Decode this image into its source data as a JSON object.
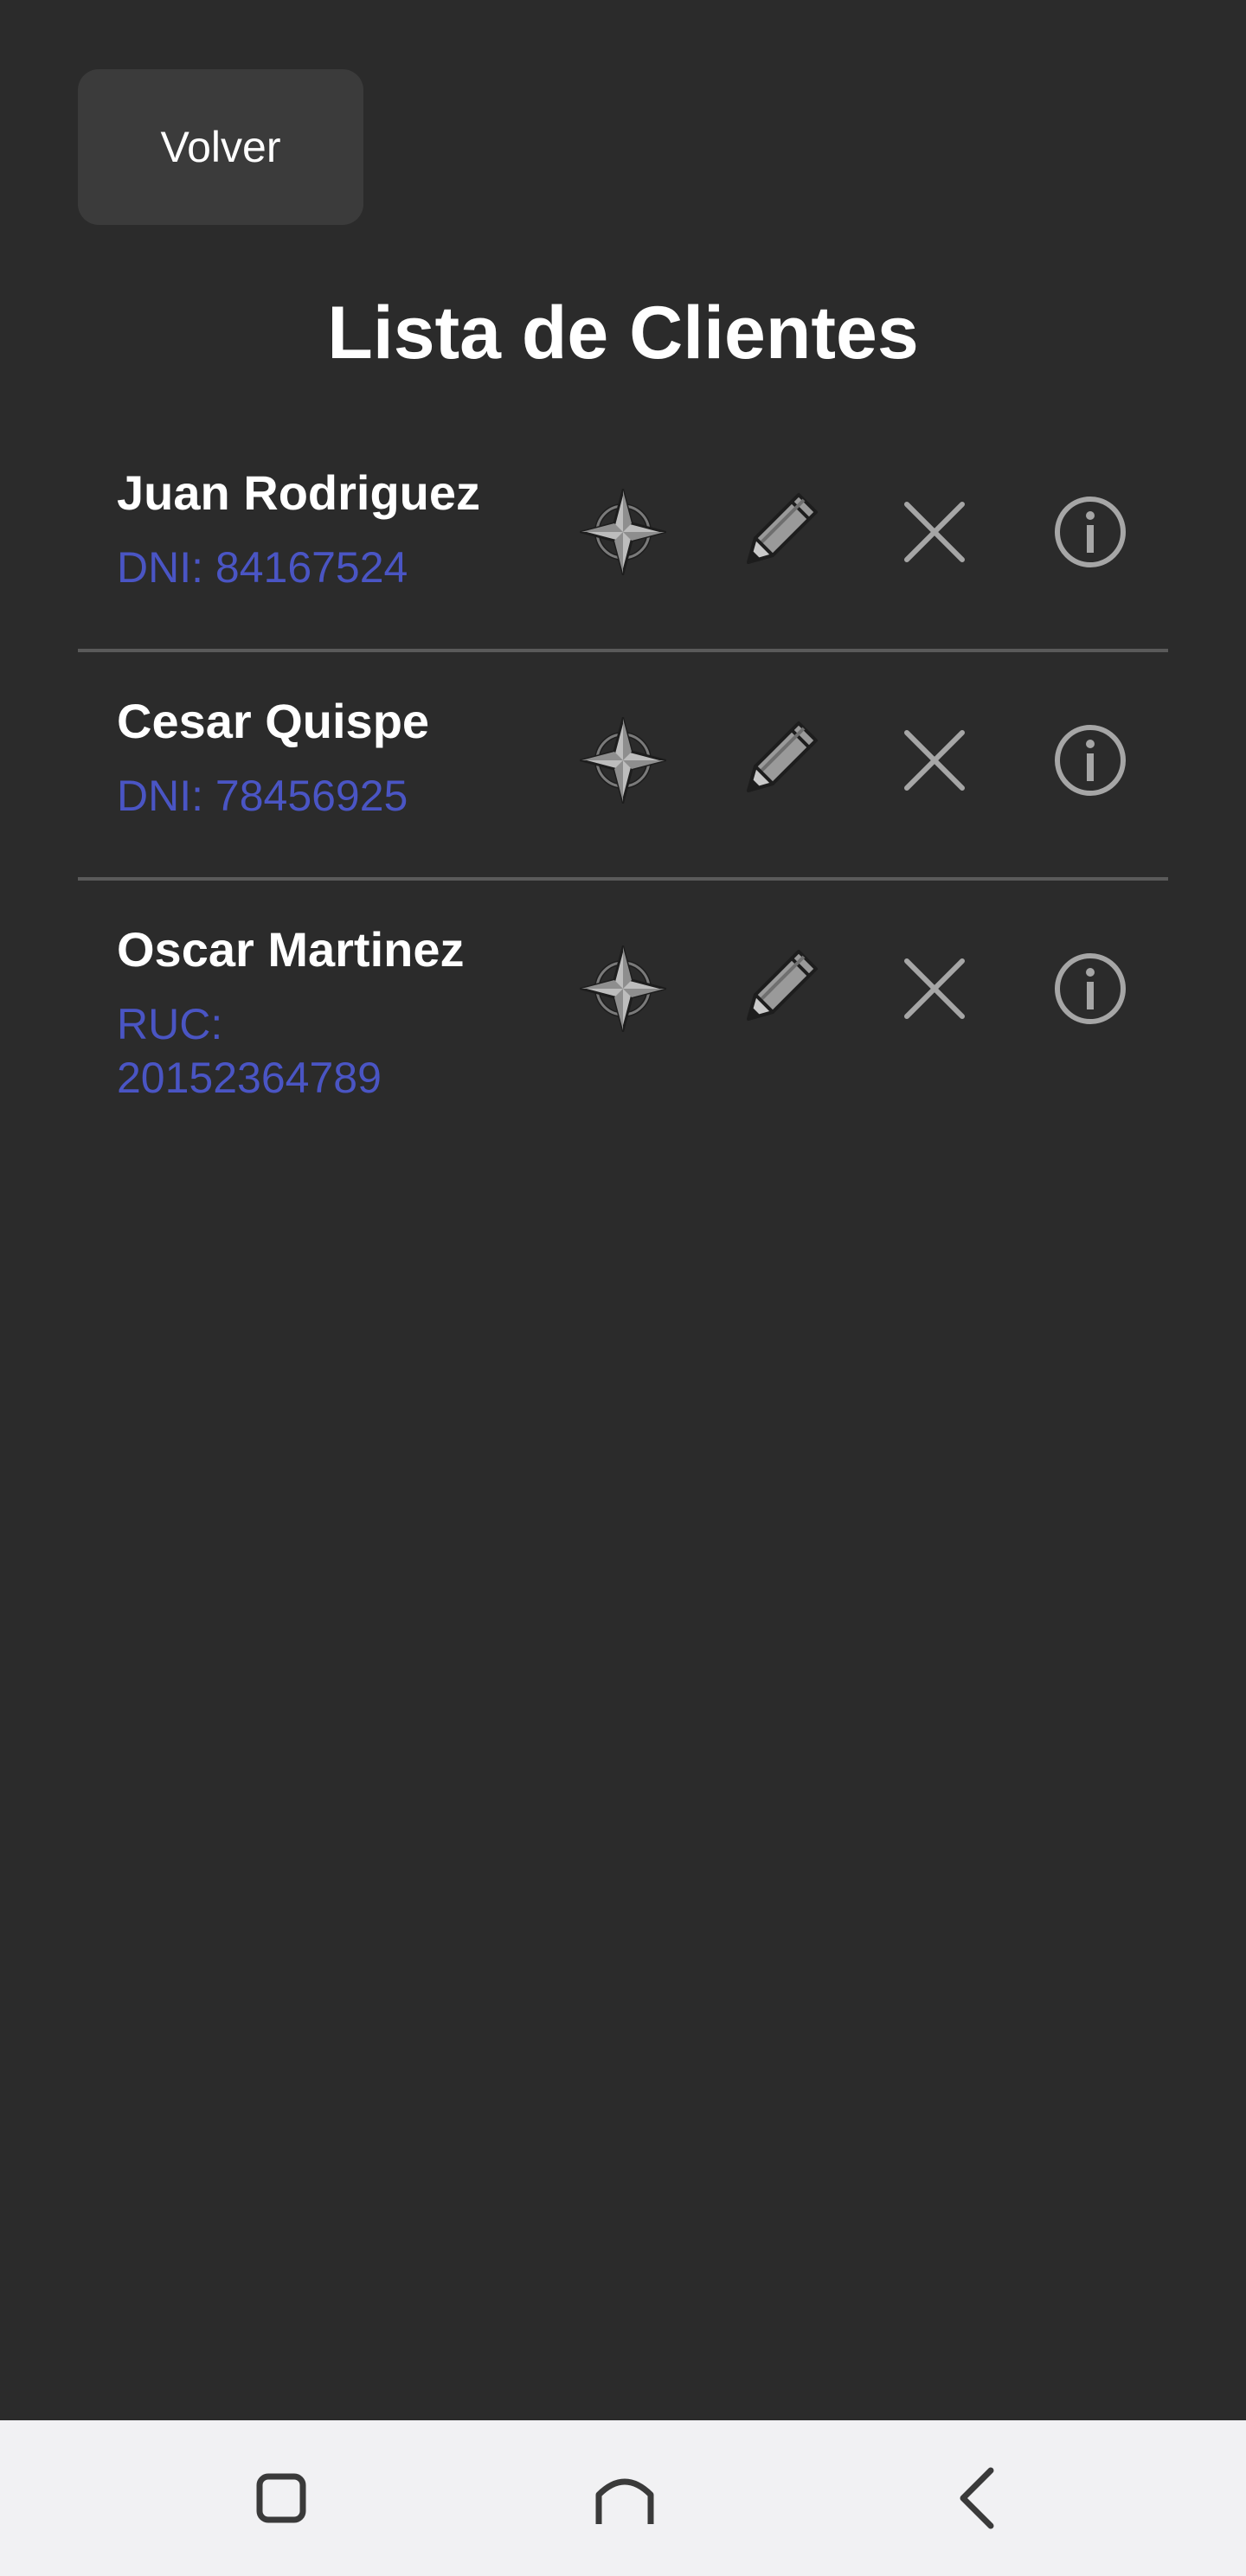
{
  "header": {
    "back_label": "Volver",
    "title": "Lista de Clientes"
  },
  "clients": [
    {
      "name": "Juan Rodriguez",
      "doc_line1": "DNI: 84167524",
      "doc_line2": ""
    },
    {
      "name": "Cesar Quispe",
      "doc_line1": "DNI: 78456925",
      "doc_line2": ""
    },
    {
      "name": "Oscar Martinez",
      "doc_line1": "RUC:",
      "doc_line2": "20152364789"
    }
  ],
  "icons": {
    "locate": "compass-locate-icon",
    "edit": "pencil-icon",
    "delete": "close-icon",
    "info": "info-icon",
    "nav_recents": "square-icon",
    "nav_home": "home-arch-icon",
    "nav_back": "chevron-left-icon"
  },
  "colors": {
    "background": "#2b2b2b",
    "button_bg": "#3b3b3b",
    "doc_text": "#4a55c4",
    "divider": "#5a5a5a",
    "navbar_bg": "#f1f1f3"
  }
}
